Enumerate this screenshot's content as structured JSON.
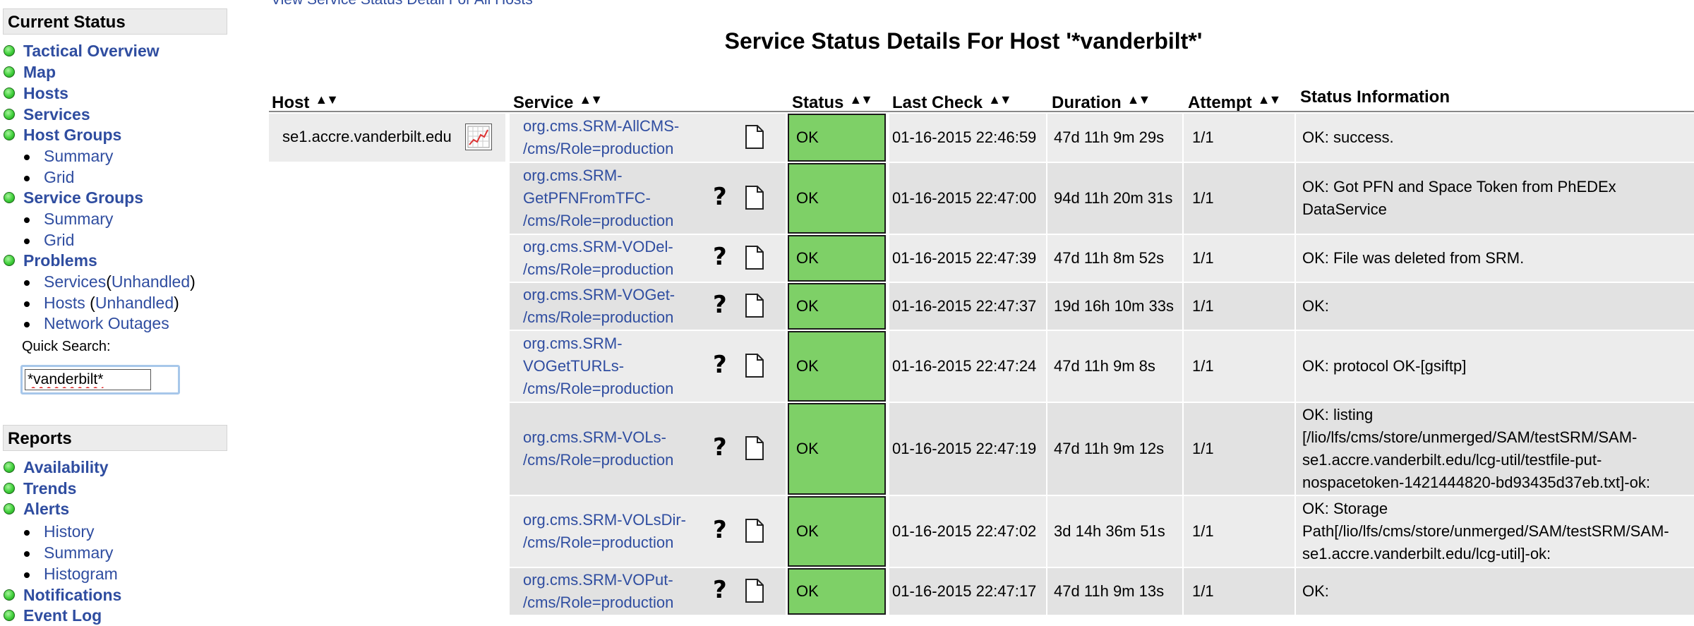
{
  "sidebar": {
    "current_status_title": "Current Status",
    "tactical_overview": "Tactical Overview",
    "map": "Map",
    "hosts": "Hosts",
    "services": "Services",
    "host_groups": "Host Groups",
    "host_groups_summary": "Summary",
    "host_groups_grid": "Grid",
    "service_groups": "Service Groups",
    "service_groups_summary": "Summary",
    "service_groups_grid": "Grid",
    "problems": "Problems",
    "problems_services": "Services",
    "problems_services_unhandled": "Unhandled",
    "problems_hosts": "Hosts",
    "problems_hosts_unhandled": "Unhandled",
    "network_outages": "Network Outages",
    "quick_search_label": "Quick Search:",
    "quick_search_value": "*vanderbilt*",
    "reports_title": "Reports",
    "availability": "Availability",
    "trends": "Trends",
    "alerts": "Alerts",
    "alerts_history": "History",
    "alerts_summary": "Summary",
    "alerts_histogram": "Histogram",
    "notifications": "Notifications",
    "event_log": "Event Log",
    "status_dot_color": "#3fcf3a"
  },
  "main": {
    "top_link": "View Service Status Detail For All Hosts",
    "title": "Service Status Details For Host '*vanderbilt*'",
    "columns": {
      "host": "Host",
      "service": "Service",
      "status": "Status",
      "last_check": "Last Check",
      "duration": "Duration",
      "attempt": "Attempt",
      "status_information": "Status Information"
    },
    "host": {
      "name": "se1.accre.vanderbilt.edu",
      "graph_icon": "graph-icon"
    },
    "status_ok_color": "#7ed067",
    "rows": [
      {
        "service": [
          "org.cms.SRM-AllCMS-",
          "/cms/Role=production"
        ],
        "status": "OK",
        "last_check": "01-16-2015 22:46:59",
        "duration": "47d 11h 9m 29s",
        "attempt": "1/1",
        "info": [
          "OK: success."
        ]
      },
      {
        "service": [
          "org.cms.SRM-",
          "GetPFNFromTFC-",
          "/cms/Role=production"
        ],
        "status": "OK",
        "last_check": "01-16-2015 22:47:00",
        "duration": "94d 11h 20m 31s",
        "attempt": "1/1",
        "info": [
          "OK: Got PFN and Space Token from PhEDEx",
          "DataService"
        ]
      },
      {
        "service": [
          "org.cms.SRM-VODel-",
          "/cms/Role=production"
        ],
        "status": "OK",
        "last_check": "01-16-2015 22:47:39",
        "duration": "47d 11h 8m 52s",
        "attempt": "1/1",
        "info": [
          "OK: File was deleted from SRM."
        ]
      },
      {
        "service": [
          "org.cms.SRM-VOGet-",
          "/cms/Role=production"
        ],
        "status": "OK",
        "last_check": "01-16-2015 22:47:37",
        "duration": "19d 16h 10m 33s",
        "attempt": "1/1",
        "info": [
          "OK:"
        ]
      },
      {
        "service": [
          "org.cms.SRM-",
          "VOGetTURLs-",
          "/cms/Role=production"
        ],
        "status": "OK",
        "last_check": "01-16-2015 22:47:24",
        "duration": "47d 11h 9m 8s",
        "attempt": "1/1",
        "info": [
          "OK: protocol OK-[gsiftp]"
        ]
      },
      {
        "service": [
          "org.cms.SRM-VOLs-",
          "/cms/Role=production"
        ],
        "status": "OK",
        "last_check": "01-16-2015 22:47:19",
        "duration": "47d 11h 9m 12s",
        "attempt": "1/1",
        "info": [
          "OK: listing",
          "[/lio/lfs/cms/store/unmerged/SAM/testSRM/SAM-",
          "se1.accre.vanderbilt.edu/lcg-util/testfile-put-",
          "nospacetoken-1421444820-bd93435d37eb.txt]-ok:"
        ]
      },
      {
        "service": [
          "org.cms.SRM-VOLsDir-",
          "/cms/Role=production"
        ],
        "status": "OK",
        "last_check": "01-16-2015 22:47:02",
        "duration": "3d 14h 36m 51s",
        "attempt": "1/1",
        "info": [
          "OK: Storage",
          "Path[/lio/lfs/cms/store/unmerged/SAM/testSRM/SAM-",
          "se1.accre.vanderbilt.edu/lcg-util]-ok:"
        ]
      },
      {
        "service": [
          "org.cms.SRM-VOPut-",
          "/cms/Role=production"
        ],
        "status": "OK",
        "last_check": "01-16-2015 22:47:17",
        "duration": "47d 11h 9m 13s",
        "attempt": "1/1",
        "info": [
          "OK:"
        ]
      }
    ]
  }
}
